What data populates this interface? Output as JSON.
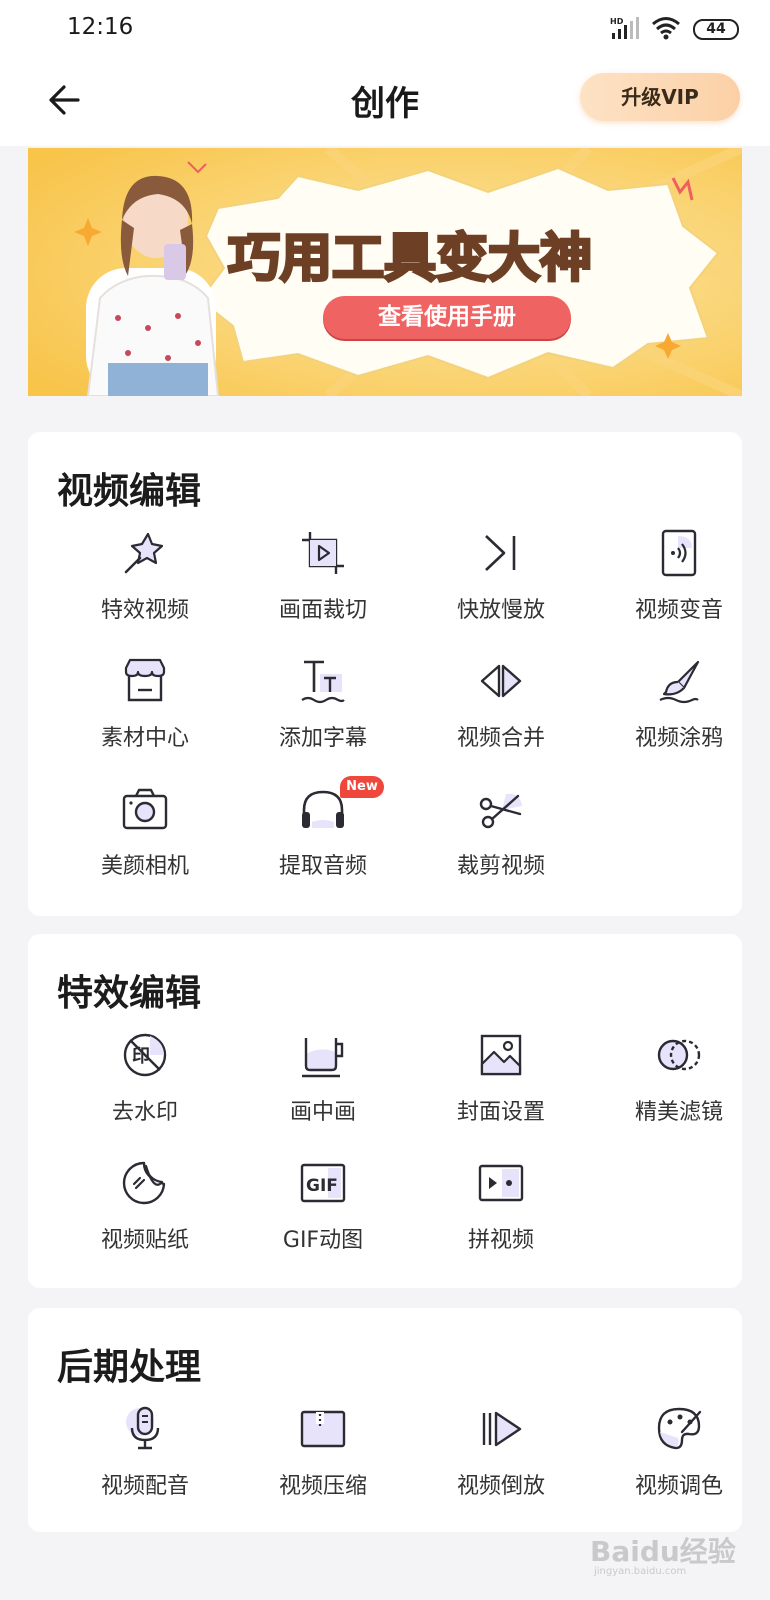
{
  "status_bar": {
    "time": "12:16",
    "network": "HD",
    "battery": "44"
  },
  "header": {
    "title": "创作",
    "vip_button": "升级VIP"
  },
  "banner": {
    "title": "巧用工具变大神",
    "button": "查看使用手册"
  },
  "sections": [
    {
      "title": "视频编辑",
      "tools": [
        {
          "label": "特效视频",
          "icon": "magic-wand-icon"
        },
        {
          "label": "画面裁切",
          "icon": "crop-icon"
        },
        {
          "label": "快放慢放",
          "icon": "speed-icon"
        },
        {
          "label": "视频变音",
          "icon": "voice-change-icon"
        },
        {
          "label": "素材中心",
          "icon": "store-icon"
        },
        {
          "label": "添加字幕",
          "icon": "subtitle-icon"
        },
        {
          "label": "视频合并",
          "icon": "merge-icon"
        },
        {
          "label": "视频涂鸦",
          "icon": "brush-icon"
        },
        {
          "label": "美颜相机",
          "icon": "camera-icon"
        },
        {
          "label": "提取音频",
          "icon": "headphones-icon",
          "badge": "New"
        },
        {
          "label": "裁剪视频",
          "icon": "scissors-icon"
        }
      ]
    },
    {
      "title": "特效编辑",
      "tools": [
        {
          "label": "去水印",
          "icon": "remove-watermark-icon"
        },
        {
          "label": "画中画",
          "icon": "picture-in-picture-icon"
        },
        {
          "label": "封面设置",
          "icon": "image-icon"
        },
        {
          "label": "精美滤镜",
          "icon": "filter-icon"
        },
        {
          "label": "视频贴纸",
          "icon": "sticker-icon"
        },
        {
          "label": "GIF动图",
          "icon": "gif-icon"
        },
        {
          "label": "拼视频",
          "icon": "collage-icon"
        }
      ]
    },
    {
      "title": "后期处理",
      "tools": [
        {
          "label": "视频配音",
          "icon": "microphone-icon"
        },
        {
          "label": "视频压缩",
          "icon": "compress-icon"
        },
        {
          "label": "视频倒放",
          "icon": "reverse-icon"
        },
        {
          "label": "视频调色",
          "icon": "palette-icon"
        }
      ]
    }
  ],
  "watermark": {
    "text": "Baidu经验",
    "sub": "jingyan.baidu.com"
  },
  "colors": {
    "accent_lavender": "#e7e3fb",
    "icon_stroke": "#2b2b33",
    "badge_red": "#f0473d",
    "banner_yellow": "#f9c94c"
  }
}
